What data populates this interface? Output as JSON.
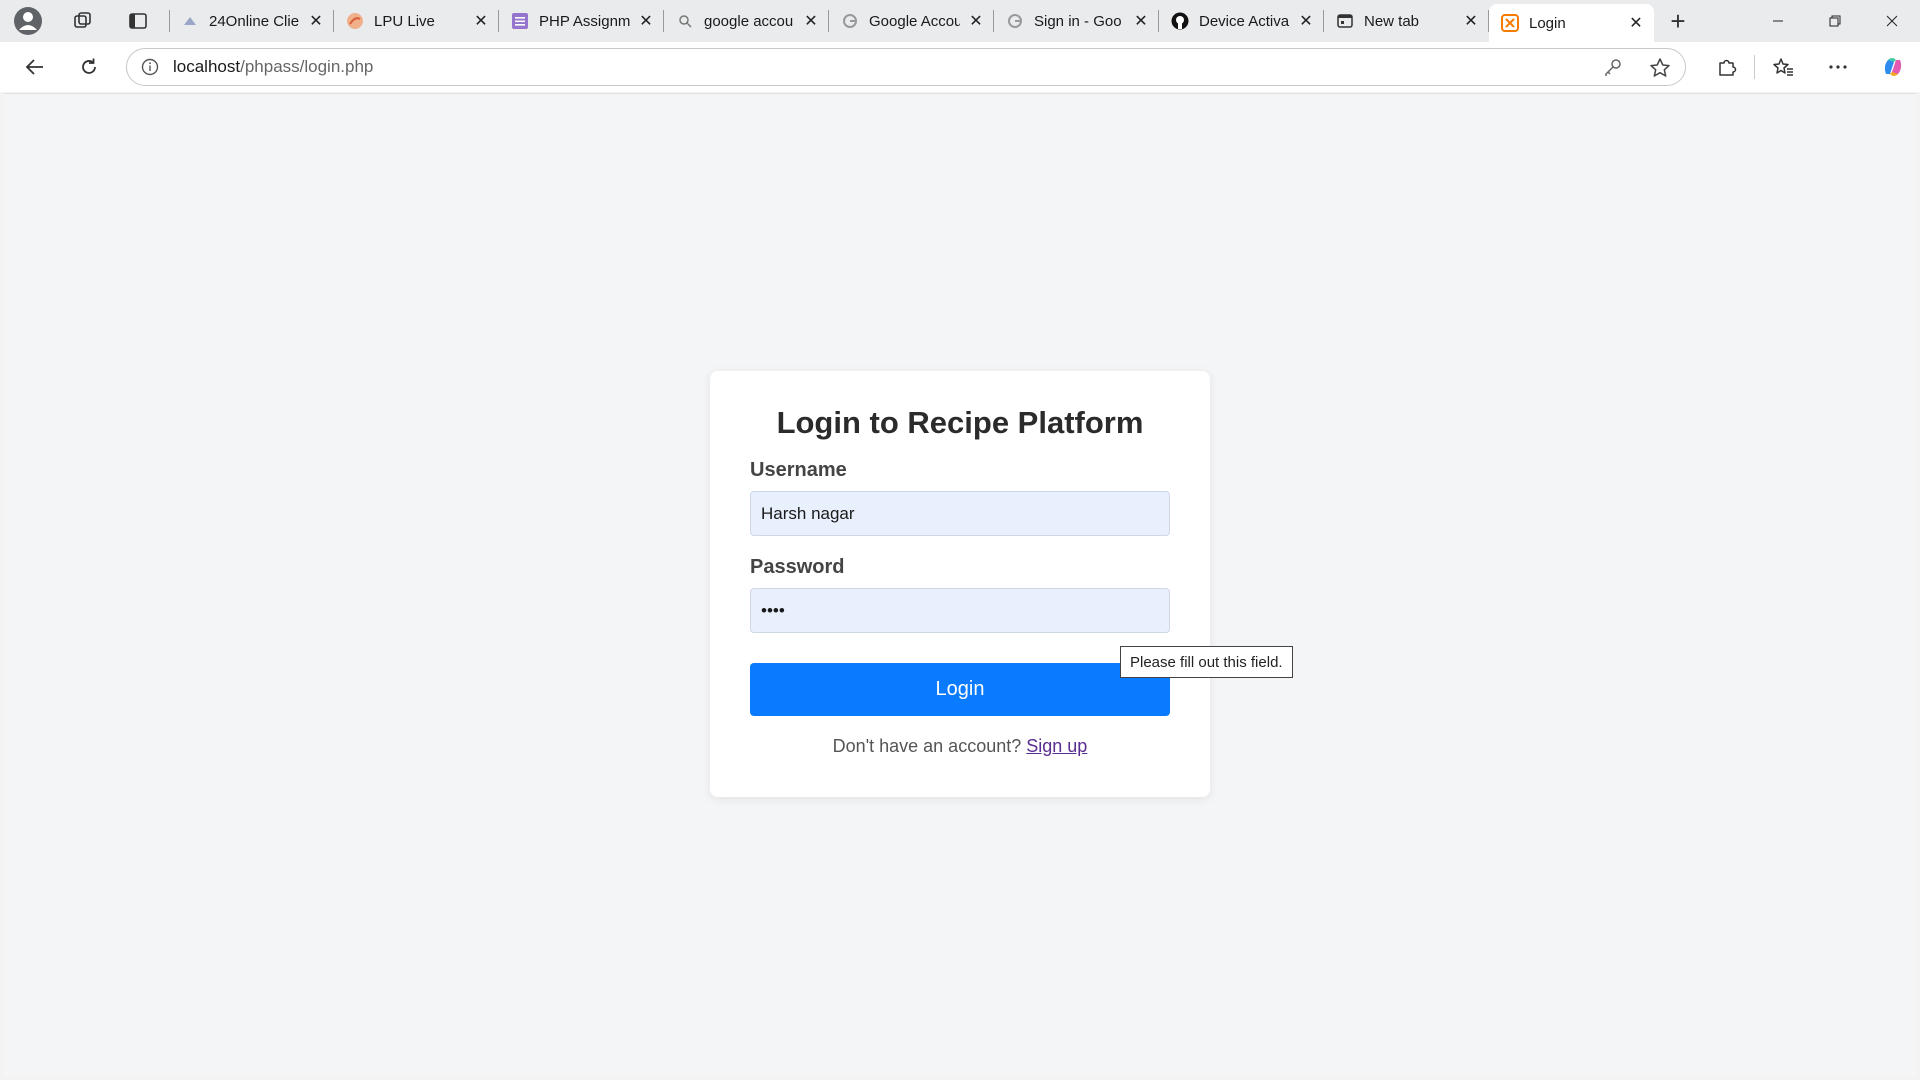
{
  "browser": {
    "tabs": [
      {
        "title": "24Online Clie",
        "favicon": "triangle-icon",
        "color": "#7a8db8"
      },
      {
        "title": "LPU Live",
        "favicon": "lpu-icon",
        "color": "#e08a5a"
      },
      {
        "title": "PHP Assignm",
        "favicon": "form-icon",
        "color": "#7e57c2"
      },
      {
        "title": "google accou",
        "favicon": "search-icon",
        "color": "#666666"
      },
      {
        "title": "Google Accou",
        "favicon": "google-icon",
        "color": "#888888"
      },
      {
        "title": "Sign in - Goo",
        "favicon": "google-icon",
        "color": "#888888"
      },
      {
        "title": "Device Activa",
        "favicon": "github-icon",
        "color": "#111111"
      },
      {
        "title": "New tab",
        "favicon": "newtab-icon",
        "color": "#333333"
      },
      {
        "title": "Login",
        "favicon": "xampp-icon",
        "color": "#f57c00",
        "active": true
      }
    ],
    "url_host": "localhost",
    "url_path": "/phpass/login.php"
  },
  "login": {
    "heading": "Login to Recipe Platform",
    "username_label": "Username",
    "username_value": "Harsh nagar",
    "password_label": "Password",
    "password_value": "••••",
    "button_label": "Login",
    "signup_prompt": "Don't have an account?",
    "signup_link": "Sign up",
    "tooltip": "Please fill out this field."
  },
  "colors": {
    "primary_button": "#0a7bff",
    "input_autofill_bg": "#e8f0fe",
    "link_visited": "#5a2d91"
  }
}
